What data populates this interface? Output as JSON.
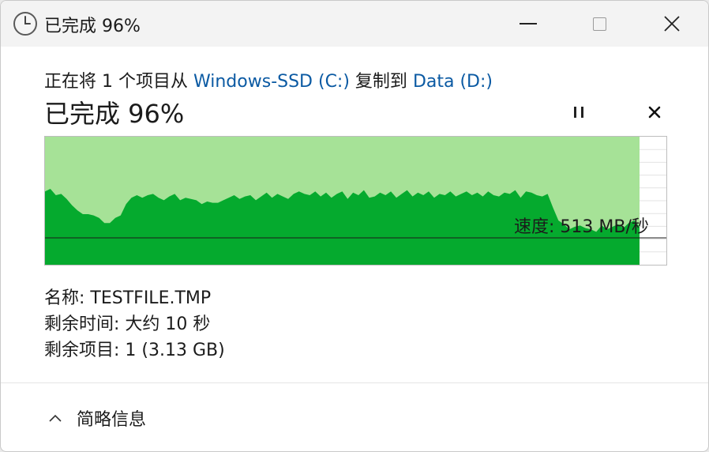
{
  "window": {
    "title": "已完成 96%"
  },
  "header": {
    "line_prefix": "正在将 1 个项目从 ",
    "source": "Windows-SSD (C:)",
    "line_mid": " 复制到 ",
    "destination": "Data (D:)",
    "progress_title": "已完成 96%"
  },
  "graph": {
    "speed_label": "速度: 513 MB/秒",
    "progress_fraction": 0.96,
    "fill_color": "#a6e297",
    "speed_color": "#05aa2e",
    "speed_series": [
      58,
      60,
      55,
      56,
      52,
      47,
      43,
      40,
      40,
      39,
      37,
      33,
      33,
      37,
      39,
      48,
      53,
      55,
      53,
      55,
      56,
      53,
      51,
      54,
      56,
      51,
      53,
      52,
      51,
      48,
      50,
      49,
      49,
      51,
      53,
      55,
      52,
      54,
      55,
      51,
      54,
      57,
      53,
      56,
      54,
      52,
      56,
      58,
      56,
      55,
      58,
      54,
      57,
      53,
      56,
      58,
      52,
      57,
      55,
      59,
      53,
      54,
      57,
      55,
      58,
      53,
      56,
      59,
      54,
      57,
      55,
      58,
      53,
      56,
      55,
      58,
      54,
      56,
      58,
      55,
      57,
      54,
      58,
      55,
      54,
      57,
      56,
      59,
      53,
      58,
      57,
      55,
      54,
      56,
      45,
      35,
      32,
      28,
      30,
      31,
      29,
      28,
      26,
      31,
      28,
      30,
      32,
      29,
      33,
      35,
      30
    ]
  },
  "info": {
    "name_label": "名称:",
    "name_value": "TESTFILE.TMP",
    "time_label": "剩余时间:",
    "time_value": "大约 10 秒",
    "items_label": "剩余项目:",
    "items_value": "1 (3.13 GB)"
  },
  "footer": {
    "details_label": "简略信息"
  },
  "icons": {
    "title": "clock-icon",
    "minimize": "minimize-icon",
    "maximize": "maximize-icon",
    "close": "close-icon",
    "pause": "pause-icon",
    "cancel": "cancel-icon",
    "details": "chevron-up-icon"
  }
}
